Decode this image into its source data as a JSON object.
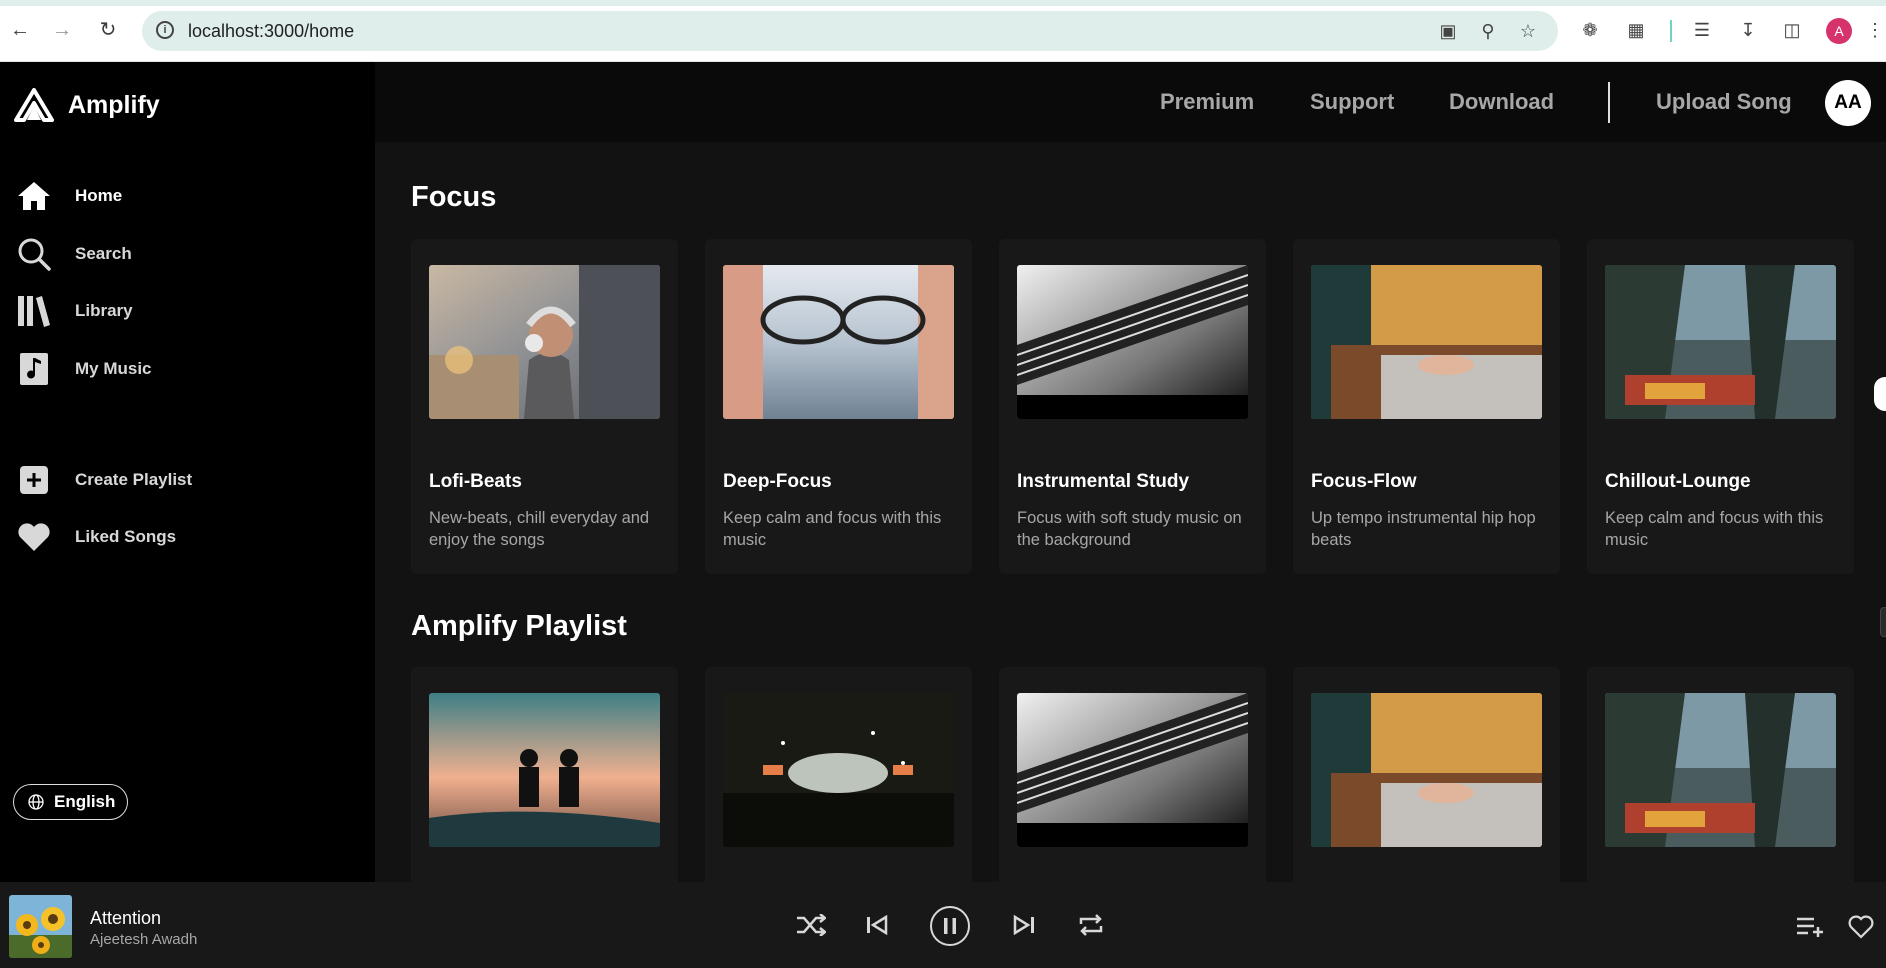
{
  "browser": {
    "url": "localhost:3000/home",
    "profile_initial": "A"
  },
  "brand": {
    "name": "Amplify"
  },
  "sidebar": {
    "items": [
      {
        "label": "Home"
      },
      {
        "label": "Search"
      },
      {
        "label": "Library"
      },
      {
        "label": "My Music"
      },
      {
        "label": "Create Playlist"
      },
      {
        "label": "Liked Songs"
      }
    ],
    "language": "English"
  },
  "topnav": {
    "premium": "Premium",
    "support": "Support",
    "download": "Download",
    "upload": "Upload Song",
    "avatar": "AA"
  },
  "sections": [
    {
      "title": "Focus",
      "cards": [
        {
          "title": "Lofi-Beats",
          "desc": "New-beats, chill everyday and enjoy the songs"
        },
        {
          "title": "Deep-Focus",
          "desc": "Keep calm and focus with this music"
        },
        {
          "title": "Instrumental Study",
          "desc": "Focus with soft study music on the background"
        },
        {
          "title": "Focus-Flow",
          "desc": "Up tempo instrumental hip hop beats"
        },
        {
          "title": "Chillout-Lounge",
          "desc": "Keep calm and focus with this music"
        }
      ]
    },
    {
      "title": "Amplify Playlist"
    }
  ],
  "player": {
    "title": "Attention",
    "artist": "Ajeetesh Awadh"
  }
}
